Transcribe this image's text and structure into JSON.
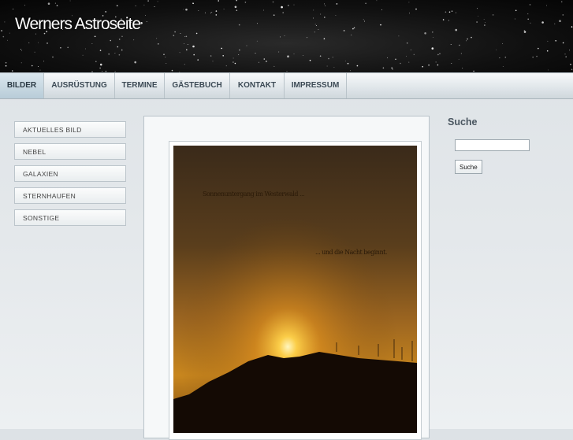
{
  "header": {
    "title": "Werners Astroseite"
  },
  "nav": {
    "items": [
      {
        "label": "BILDER",
        "active": true
      },
      {
        "label": "AUSRÜSTUNG"
      },
      {
        "label": "TERMINE"
      },
      {
        "label": "GÄSTEBUCH"
      },
      {
        "label": "KONTAKT"
      },
      {
        "label": "IMPRESSUM"
      }
    ]
  },
  "sidebar": {
    "items": [
      {
        "label": "AKTUELLES BILD"
      },
      {
        "label": "NEBEL"
      },
      {
        "label": "GALAXIEN"
      },
      {
        "label": "STERNHAUFEN"
      },
      {
        "label": "SONSTIGE"
      }
    ]
  },
  "main": {
    "photo": {
      "caption_line1": "Sonnenuntergang im Westerwald ...",
      "caption_line2": "... und die Nacht beginnt."
    }
  },
  "search": {
    "title": "Suche",
    "placeholder": "",
    "button_label": "Suche"
  },
  "colors": {
    "accent": "#b8ccd8",
    "nav_text": "#3c4a55"
  }
}
